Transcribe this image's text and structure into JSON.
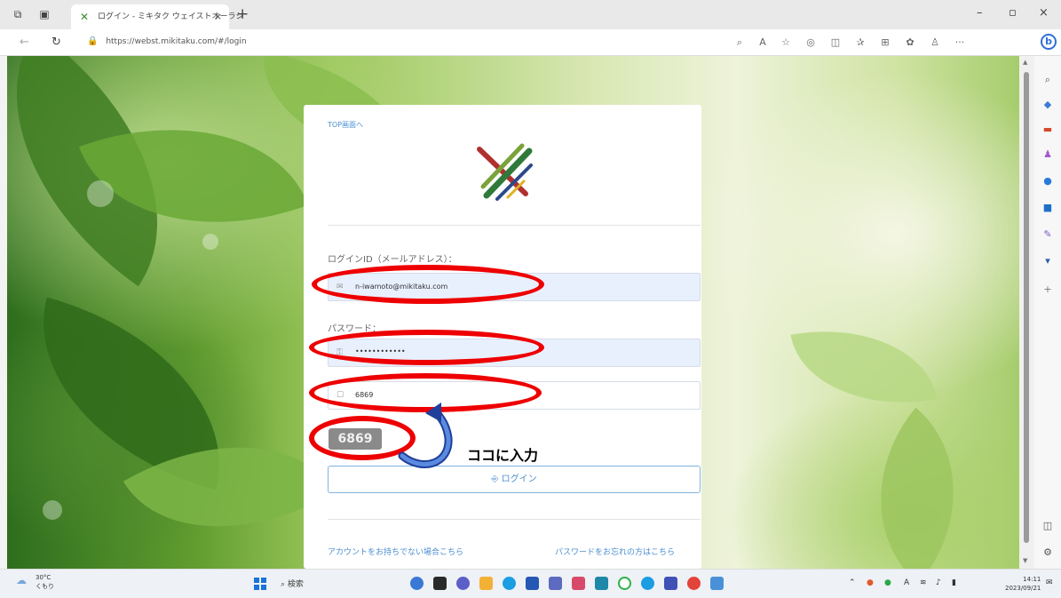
{
  "browser": {
    "tab_title": "ログイン - ミキタク ウェイストオーラシ",
    "tab_close": "×",
    "new_tab": "+",
    "url": "https://webst.mikitaku.com/#/login",
    "window_controls": {
      "minimize": "–",
      "maximize": "▫",
      "close": "×"
    },
    "bing_label": "b",
    "more_label": "···"
  },
  "login": {
    "top_link": "TOP画面へ",
    "id_label": "ログインID（メールアドレス）：",
    "id_value": "n-iwamoto@mikitaku.com",
    "password_label": "パスワード：",
    "password_value": "••••••••••••",
    "captcha_value": "6869",
    "captcha_image_text": "6869",
    "login_button": "ログイン",
    "no_account_link": "アカウントをお持ちでない場合こちら",
    "forgot_password_link": "パスワードをお忘れの方はこちら"
  },
  "annotation": {
    "text": "ココに入力",
    "color": "#ee0000"
  },
  "taskbar": {
    "weather_temp": "30°C",
    "weather_desc": "くもり",
    "search_label": "検索",
    "time": "14:11",
    "date": "2023/09/21",
    "ime": "A"
  },
  "icons": [
    "tab-actions-icon",
    "workspaces-icon",
    "refresh-icon",
    "back-icon",
    "lock-icon",
    "read-aloud-icon",
    "favorites-icon",
    "collections-icon",
    "extensions-icon",
    "profile-icon",
    "search-icon",
    "shopping-icon",
    "tools-icon",
    "office-icon",
    "outlook-icon",
    "settings-icon",
    "windows-start-icon"
  ]
}
